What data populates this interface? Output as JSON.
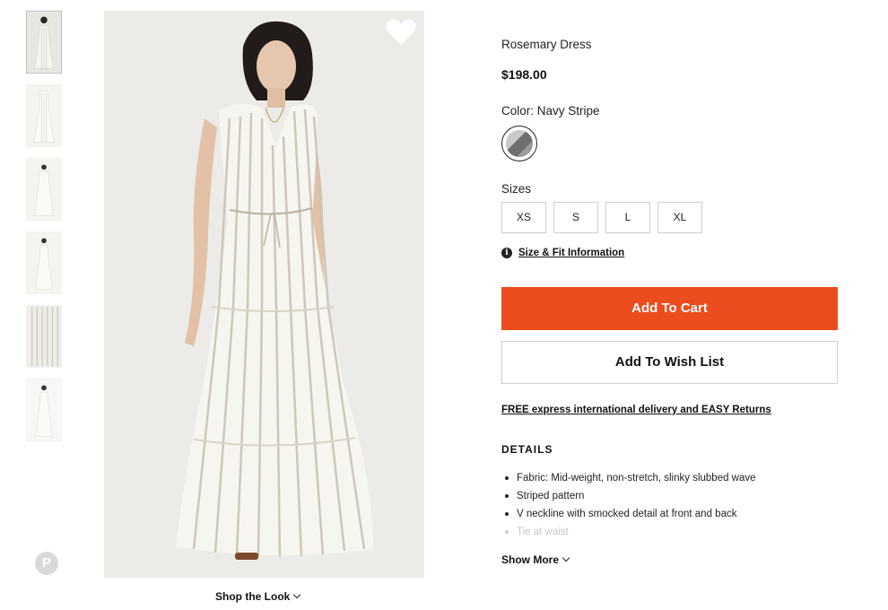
{
  "product": {
    "title": "Rosemary Dress",
    "price": "$198.00"
  },
  "color": {
    "label": "Color: Navy Stripe",
    "selected": "Navy Stripe",
    "accent": "#ec4d1f"
  },
  "sizes": {
    "label": "Sizes",
    "options": [
      "XS",
      "S",
      "L",
      "XL"
    ]
  },
  "fit_info": {
    "icon": "info-icon",
    "label": "Size & Fit Information"
  },
  "actions": {
    "add_to_cart": "Add To Cart",
    "add_to_wish_list": "Add To Wish List"
  },
  "delivery_link": "FREE express international delivery and EASY Returns",
  "details": {
    "heading": "DETAILS",
    "items": [
      "Fabric: Mid-weight, non-stretch, slinky slubbed wave",
      "Striped pattern",
      "V neckline with smocked detail at front and back",
      "Tie at waist"
    ],
    "show_more": "Show More"
  },
  "gallery": {
    "thumbnail_count": 6,
    "shop_the_look": "Shop the Look",
    "favorite_icon": "heart-icon",
    "share_icon": "pinterest-icon"
  }
}
